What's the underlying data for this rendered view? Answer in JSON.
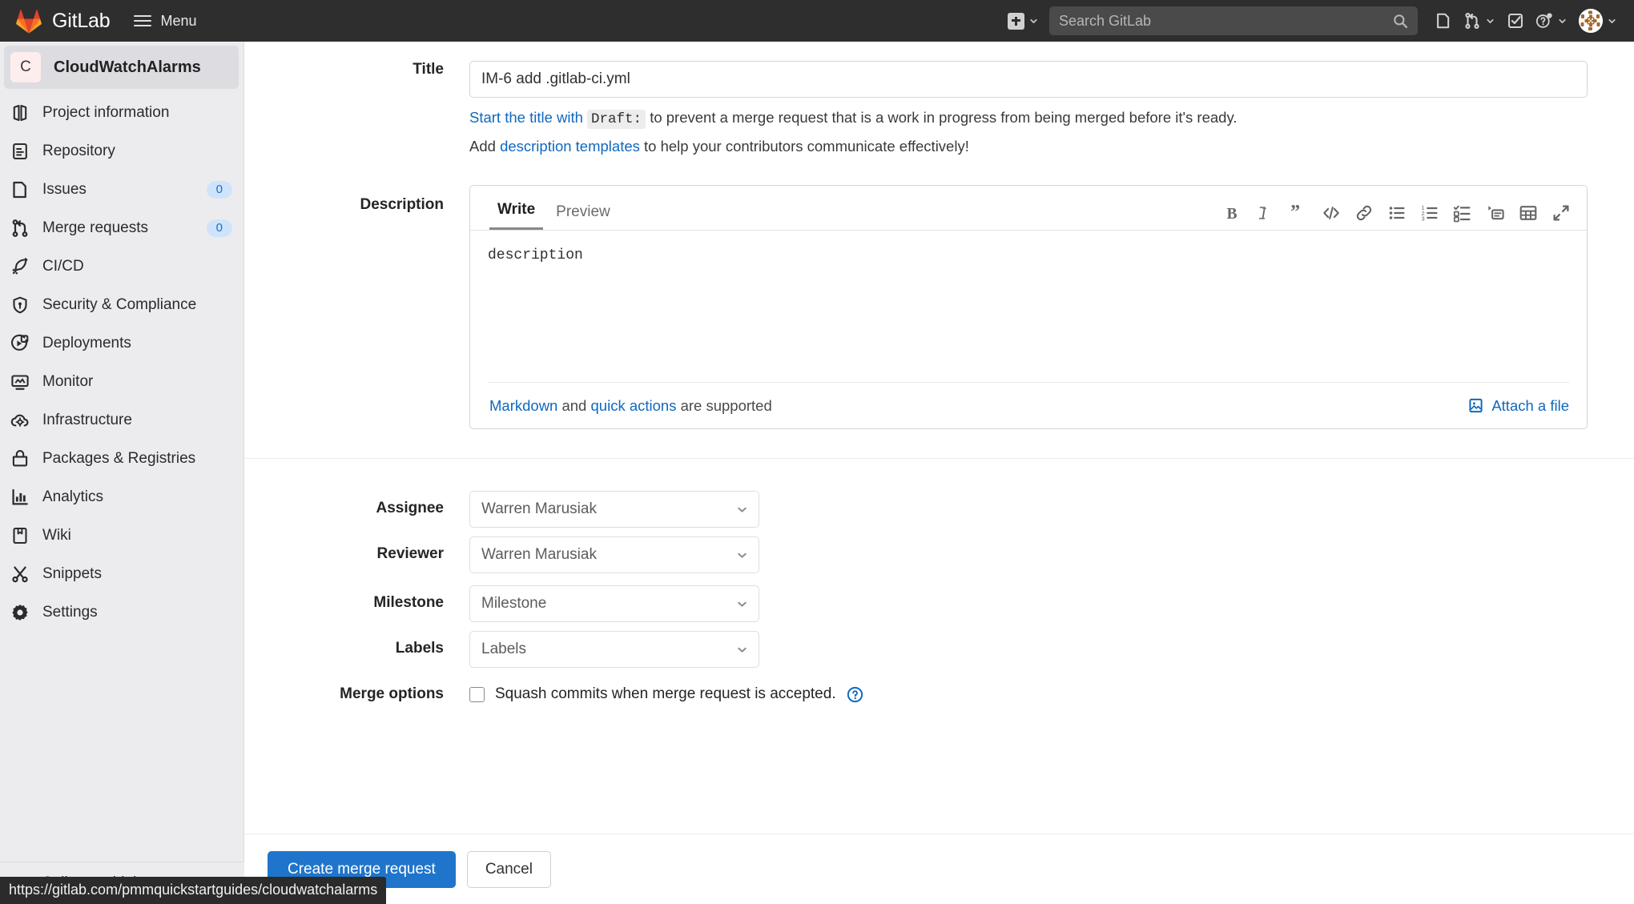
{
  "navbar": {
    "brand": "GitLab",
    "menu_label": "Menu",
    "new_icon": "plus-square-icon",
    "new_chevron_icon": "chevron-down-icon",
    "search_placeholder": "Search GitLab",
    "search_icon": "search-icon",
    "issues_icon": "issues-icon",
    "merge_requests_icon": "merge-request-icon",
    "merge_requests_chevron_icon": "chevron-down-icon",
    "todos_icon": "todo-checkbox-icon",
    "help_icon": "help-question-icon",
    "help_chevron_icon": "chevron-down-icon",
    "avatar_icon": "user-avatar",
    "avatar_chevron_icon": "chevron-down-icon"
  },
  "sidebar": {
    "project": {
      "initial": "C",
      "name": "CloudWatchAlarms"
    },
    "items": [
      {
        "label": "Project information",
        "icon": "project-info-icon",
        "badge": ""
      },
      {
        "label": "Repository",
        "icon": "repository-icon",
        "badge": ""
      },
      {
        "label": "Issues",
        "icon": "issues-icon",
        "badge": "0"
      },
      {
        "label": "Merge requests",
        "icon": "merge-request-icon",
        "badge": "0"
      },
      {
        "label": "CI/CD",
        "icon": "rocket-icon",
        "badge": ""
      },
      {
        "label": "Security & Compliance",
        "icon": "shield-icon",
        "badge": ""
      },
      {
        "label": "Deployments",
        "icon": "deployments-icon",
        "badge": ""
      },
      {
        "label": "Monitor",
        "icon": "monitor-icon",
        "badge": ""
      },
      {
        "label": "Infrastructure",
        "icon": "cloud-gear-icon",
        "badge": ""
      },
      {
        "label": "Packages & Registries",
        "icon": "package-icon",
        "badge": ""
      },
      {
        "label": "Analytics",
        "icon": "chart-icon",
        "badge": ""
      },
      {
        "label": "Wiki",
        "icon": "book-icon",
        "badge": ""
      },
      {
        "label": "Snippets",
        "icon": "scissors-icon",
        "badge": ""
      },
      {
        "label": "Settings",
        "icon": "gear-icon",
        "badge": ""
      }
    ],
    "collapse_label": "Collapse sidebar",
    "collapse_icon": "double-chevron-left-icon"
  },
  "form": {
    "title": {
      "label": "Title",
      "value": "IM-6 add .gitlab-ci.yml",
      "hint1_link": "Start the title with",
      "hint1_code": "Draft:",
      "hint1_rest": "to prevent a merge request that is a work in progress from being merged before it's ready.",
      "hint2_prefix": "Add",
      "hint2_link": "description templates",
      "hint2_rest": "to help your contributors communicate effectively!"
    },
    "description": {
      "label": "Description",
      "tab_write": "Write",
      "tab_preview": "Preview",
      "value": "description",
      "toolbar": [
        {
          "name": "bold-icon",
          "title": "Bold"
        },
        {
          "name": "italic-icon",
          "title": "Italic"
        },
        {
          "name": "quote-icon",
          "title": "Quote"
        },
        {
          "name": "code-icon",
          "title": "Code"
        },
        {
          "name": "link-icon",
          "title": "Link"
        },
        {
          "name": "bulleted-list-icon",
          "title": "Bulleted list"
        },
        {
          "name": "numbered-list-icon",
          "title": "Numbered list"
        },
        {
          "name": "task-list-icon",
          "title": "Task list"
        },
        {
          "name": "collapsible-section-icon",
          "title": "Collapsible section"
        },
        {
          "name": "table-icon",
          "title": "Table"
        },
        {
          "name": "fullscreen-icon",
          "title": "Go full screen"
        }
      ],
      "footer_markdown": "Markdown",
      "footer_and": "and",
      "footer_quick_actions": "quick actions",
      "footer_supported": "are supported",
      "attach_label": "Attach a file",
      "attach_icon": "paperclip-image-icon"
    },
    "assignee": {
      "label": "Assignee",
      "value": "Warren Marusiak",
      "chevron_icon": "chevron-down-icon"
    },
    "reviewer": {
      "label": "Reviewer",
      "value": "Warren Marusiak",
      "chevron_icon": "chevron-down-icon"
    },
    "milestone": {
      "label": "Milestone",
      "value": "Milestone",
      "chevron_icon": "chevron-down-icon"
    },
    "labels": {
      "label": "Labels",
      "value": "Labels",
      "chevron_icon": "chevron-down-icon"
    },
    "merge_options": {
      "label": "Merge options",
      "squash_label": "Squash commits when merge request is accepted.",
      "checked": false,
      "help_icon": "question-circle-icon"
    }
  },
  "actions": {
    "submit_label": "Create merge request",
    "cancel_label": "Cancel"
  },
  "statusbar": {
    "url": "https://gitlab.com/pmmquickstartguides/cloudwatchalarms"
  },
  "colors": {
    "navbar_bg": "#2e2e2e",
    "sidebar_bg": "#ececef",
    "link": "#1068bf",
    "primary_button": "#1f75cb",
    "badge_bg": "#cfe4fb",
    "badge_text": "#1f6fc4"
  }
}
